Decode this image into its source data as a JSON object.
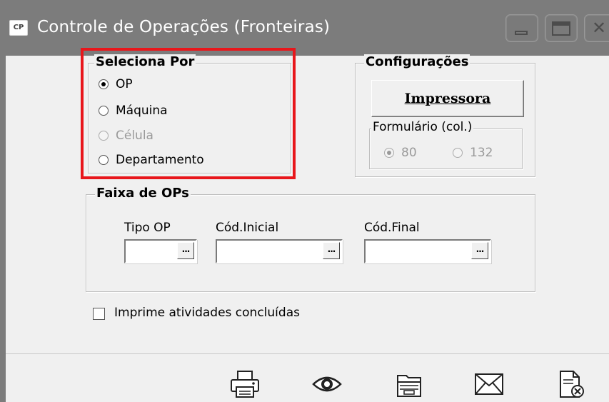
{
  "window": {
    "app_icon_label": "CP",
    "title": "Controle de Operações (Fronteiras)"
  },
  "seleciona": {
    "legend": "Seleciona Por",
    "options": [
      {
        "label": "OP",
        "checked": true,
        "enabled": true
      },
      {
        "label": "Máquina",
        "checked": false,
        "enabled": true
      },
      {
        "label": "Célula",
        "checked": false,
        "enabled": false
      },
      {
        "label": "Departamento",
        "checked": false,
        "enabled": true
      }
    ]
  },
  "configuracoes": {
    "legend": "Configurações",
    "printer_button": "Impressora",
    "formulario": {
      "legend": "Formulário (col.)",
      "options": [
        {
          "label": "80",
          "checked": true,
          "enabled": false
        },
        {
          "label": "132",
          "checked": false,
          "enabled": false
        }
      ]
    }
  },
  "faixa": {
    "legend": "Faixa de OPs",
    "tipo_label": "Tipo OP",
    "inicial_label": "Cód.Inicial",
    "final_label": "Cód.Final",
    "tipo_value": "",
    "inicial_value": "",
    "final_value": "",
    "lookup_glyph": "..."
  },
  "checkbox": {
    "label": "Imprime atividades concluídas",
    "checked": false
  },
  "toolbar": {
    "icons": [
      "printer-icon",
      "preview-eye-icon",
      "folder-icon",
      "email-icon",
      "cancel-document-icon"
    ]
  },
  "colors": {
    "titlebar": "#7c7c7c",
    "highlight": "#e8161b",
    "background": "#f0f0f0"
  }
}
